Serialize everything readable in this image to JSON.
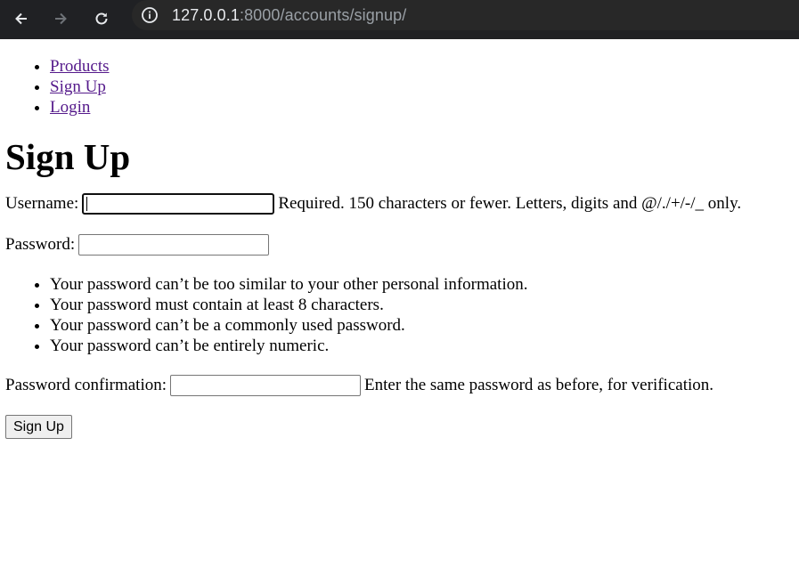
{
  "browser": {
    "url_host": "127.0.0.1",
    "url_path": ":8000/accounts/signup/"
  },
  "nav": {
    "items": [
      "Products",
      "Sign Up",
      "Login"
    ]
  },
  "page": {
    "title": "Sign Up"
  },
  "form": {
    "username": {
      "label": "Username:",
      "value": "",
      "help": "Required. 150 characters or fewer. Letters, digits and @/./+/-/_ only."
    },
    "password": {
      "label": "Password:",
      "value": "",
      "help": [
        "Your password can’t be too similar to your other personal information.",
        "Your password must contain at least 8 characters.",
        "Your password can’t be a commonly used password.",
        "Your password can’t be entirely numeric."
      ]
    },
    "password_confirmation": {
      "label": "Password confirmation:",
      "value": "",
      "help": "Enter the same password as before, for verification."
    },
    "submit_label": "Sign Up"
  },
  "icons": {
    "back": "back-arrow-icon",
    "forward": "forward-arrow-icon",
    "reload": "reload-icon",
    "site_info": "info-icon"
  },
  "colors": {
    "browser_bar": "#202124",
    "visited_link": "#551a8b"
  }
}
